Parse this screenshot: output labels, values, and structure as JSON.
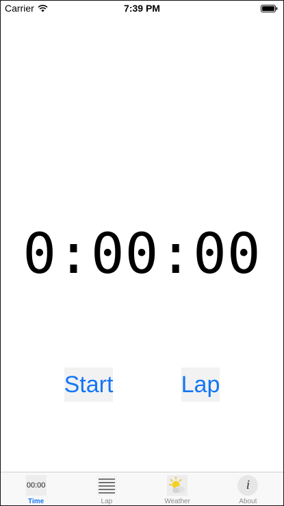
{
  "status_bar": {
    "carrier": "Carrier",
    "time": "7:39 PM"
  },
  "timer": {
    "display": "0:00:00"
  },
  "buttons": {
    "start": "Start",
    "lap": "Lap"
  },
  "tab_bar": {
    "tabs": [
      {
        "label": "Time",
        "icon": "clock-text-icon",
        "icon_text": "00:00",
        "active": true
      },
      {
        "label": "Lap",
        "icon": "lap-list-icon",
        "active": false
      },
      {
        "label": "Weather",
        "icon": "weather-sun-cloud-icon",
        "active": false
      },
      {
        "label": "About",
        "icon": "info-icon",
        "icon_text": "i",
        "active": false
      }
    ]
  },
  "colors": {
    "accent": "#1476f5",
    "button_bg": "#f2f2f2",
    "tab_inactive": "#8a8a8a"
  }
}
